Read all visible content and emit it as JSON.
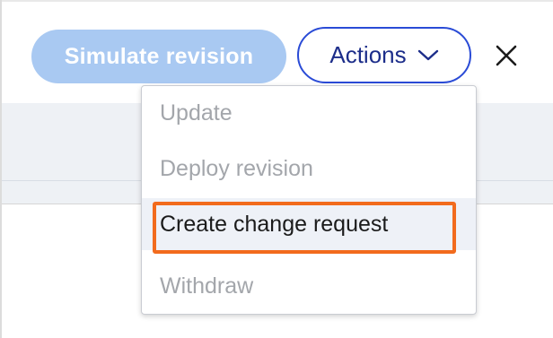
{
  "toolbar": {
    "simulate_label": "Simulate revision",
    "actions_label": "Actions",
    "actions_icon": "chevron-down-icon",
    "close_icon": "close-icon"
  },
  "menu": {
    "items": [
      {
        "label": "Update",
        "enabled": false
      },
      {
        "label": "Deploy revision",
        "enabled": false
      },
      {
        "label": "Create change request",
        "enabled": true,
        "highlighted": true
      },
      {
        "label": "Withdraw",
        "enabled": false
      }
    ]
  },
  "colors": {
    "primary_disabled": "#a9c9f2",
    "actions_border": "#2a4bd6",
    "highlight": "#f26b1d",
    "disabled_text": "#a3a6ab"
  }
}
